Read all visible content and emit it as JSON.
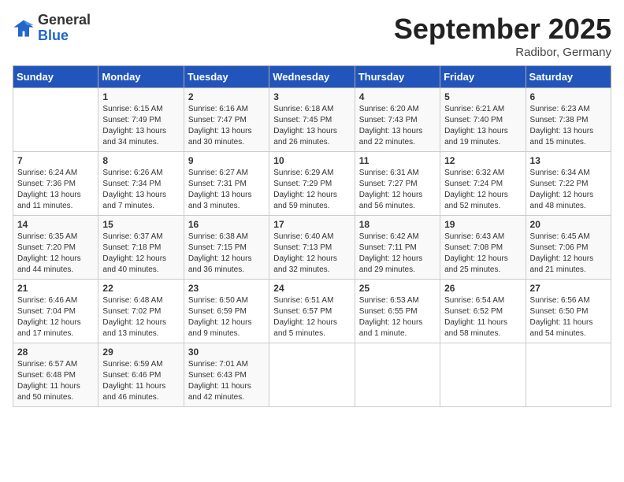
{
  "header": {
    "logo_general": "General",
    "logo_blue": "Blue",
    "month_title": "September 2025",
    "location": "Radibor, Germany"
  },
  "weekdays": [
    "Sunday",
    "Monday",
    "Tuesday",
    "Wednesday",
    "Thursday",
    "Friday",
    "Saturday"
  ],
  "weeks": [
    [
      {
        "day": "",
        "info": ""
      },
      {
        "day": "1",
        "info": "Sunrise: 6:15 AM\nSunset: 7:49 PM\nDaylight: 13 hours\nand 34 minutes."
      },
      {
        "day": "2",
        "info": "Sunrise: 6:16 AM\nSunset: 7:47 PM\nDaylight: 13 hours\nand 30 minutes."
      },
      {
        "day": "3",
        "info": "Sunrise: 6:18 AM\nSunset: 7:45 PM\nDaylight: 13 hours\nand 26 minutes."
      },
      {
        "day": "4",
        "info": "Sunrise: 6:20 AM\nSunset: 7:43 PM\nDaylight: 13 hours\nand 22 minutes."
      },
      {
        "day": "5",
        "info": "Sunrise: 6:21 AM\nSunset: 7:40 PM\nDaylight: 13 hours\nand 19 minutes."
      },
      {
        "day": "6",
        "info": "Sunrise: 6:23 AM\nSunset: 7:38 PM\nDaylight: 13 hours\nand 15 minutes."
      }
    ],
    [
      {
        "day": "7",
        "info": "Sunrise: 6:24 AM\nSunset: 7:36 PM\nDaylight: 13 hours\nand 11 minutes."
      },
      {
        "day": "8",
        "info": "Sunrise: 6:26 AM\nSunset: 7:34 PM\nDaylight: 13 hours\nand 7 minutes."
      },
      {
        "day": "9",
        "info": "Sunrise: 6:27 AM\nSunset: 7:31 PM\nDaylight: 13 hours\nand 3 minutes."
      },
      {
        "day": "10",
        "info": "Sunrise: 6:29 AM\nSunset: 7:29 PM\nDaylight: 12 hours\nand 59 minutes."
      },
      {
        "day": "11",
        "info": "Sunrise: 6:31 AM\nSunset: 7:27 PM\nDaylight: 12 hours\nand 56 minutes."
      },
      {
        "day": "12",
        "info": "Sunrise: 6:32 AM\nSunset: 7:24 PM\nDaylight: 12 hours\nand 52 minutes."
      },
      {
        "day": "13",
        "info": "Sunrise: 6:34 AM\nSunset: 7:22 PM\nDaylight: 12 hours\nand 48 minutes."
      }
    ],
    [
      {
        "day": "14",
        "info": "Sunrise: 6:35 AM\nSunset: 7:20 PM\nDaylight: 12 hours\nand 44 minutes."
      },
      {
        "day": "15",
        "info": "Sunrise: 6:37 AM\nSunset: 7:18 PM\nDaylight: 12 hours\nand 40 minutes."
      },
      {
        "day": "16",
        "info": "Sunrise: 6:38 AM\nSunset: 7:15 PM\nDaylight: 12 hours\nand 36 minutes."
      },
      {
        "day": "17",
        "info": "Sunrise: 6:40 AM\nSunset: 7:13 PM\nDaylight: 12 hours\nand 32 minutes."
      },
      {
        "day": "18",
        "info": "Sunrise: 6:42 AM\nSunset: 7:11 PM\nDaylight: 12 hours\nand 29 minutes."
      },
      {
        "day": "19",
        "info": "Sunrise: 6:43 AM\nSunset: 7:08 PM\nDaylight: 12 hours\nand 25 minutes."
      },
      {
        "day": "20",
        "info": "Sunrise: 6:45 AM\nSunset: 7:06 PM\nDaylight: 12 hours\nand 21 minutes."
      }
    ],
    [
      {
        "day": "21",
        "info": "Sunrise: 6:46 AM\nSunset: 7:04 PM\nDaylight: 12 hours\nand 17 minutes."
      },
      {
        "day": "22",
        "info": "Sunrise: 6:48 AM\nSunset: 7:02 PM\nDaylight: 12 hours\nand 13 minutes."
      },
      {
        "day": "23",
        "info": "Sunrise: 6:50 AM\nSunset: 6:59 PM\nDaylight: 12 hours\nand 9 minutes."
      },
      {
        "day": "24",
        "info": "Sunrise: 6:51 AM\nSunset: 6:57 PM\nDaylight: 12 hours\nand 5 minutes."
      },
      {
        "day": "25",
        "info": "Sunrise: 6:53 AM\nSunset: 6:55 PM\nDaylight: 12 hours\nand 1 minute."
      },
      {
        "day": "26",
        "info": "Sunrise: 6:54 AM\nSunset: 6:52 PM\nDaylight: 11 hours\nand 58 minutes."
      },
      {
        "day": "27",
        "info": "Sunrise: 6:56 AM\nSunset: 6:50 PM\nDaylight: 11 hours\nand 54 minutes."
      }
    ],
    [
      {
        "day": "28",
        "info": "Sunrise: 6:57 AM\nSunset: 6:48 PM\nDaylight: 11 hours\nand 50 minutes."
      },
      {
        "day": "29",
        "info": "Sunrise: 6:59 AM\nSunset: 6:46 PM\nDaylight: 11 hours\nand 46 minutes."
      },
      {
        "day": "30",
        "info": "Sunrise: 7:01 AM\nSunset: 6:43 PM\nDaylight: 11 hours\nand 42 minutes."
      },
      {
        "day": "",
        "info": ""
      },
      {
        "day": "",
        "info": ""
      },
      {
        "day": "",
        "info": ""
      },
      {
        "day": "",
        "info": ""
      }
    ]
  ]
}
